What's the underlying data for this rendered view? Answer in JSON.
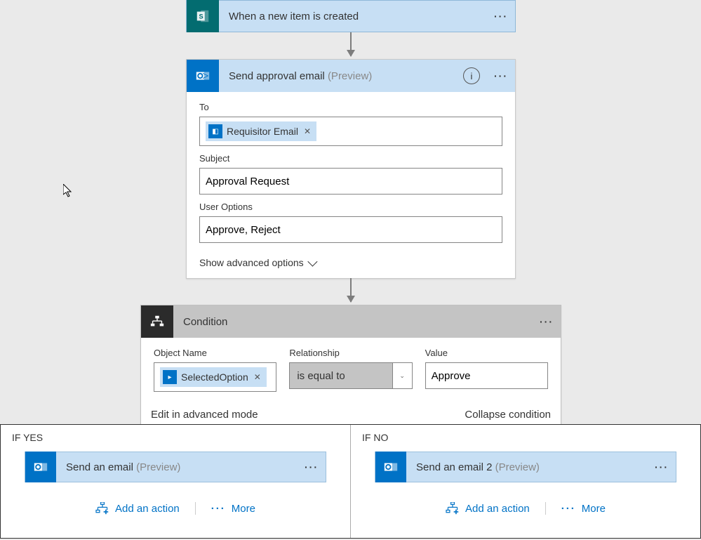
{
  "trigger": {
    "title": "When a new item is created",
    "icon": "sharepoint-icon"
  },
  "emailAction": {
    "title": "Send approval email",
    "preview": "(Preview)",
    "fields": {
      "toLabel": "To",
      "toToken": "Requisitor Email",
      "subjectLabel": "Subject",
      "subjectValue": "Approval Request",
      "optionsLabel": "User Options",
      "optionsValue": "Approve, Reject"
    },
    "showAdvanced": "Show advanced options"
  },
  "condition": {
    "title": "Condition",
    "objectLabel": "Object Name",
    "objectToken": "SelectedOption",
    "relationLabel": "Relationship",
    "relationValue": "is equal to",
    "valueLabel": "Value",
    "valueValue": "Approve",
    "editAdvanced": "Edit in advanced mode",
    "collapse": "Collapse condition"
  },
  "branches": {
    "yes": {
      "label": "IF YES",
      "action": {
        "title": "Send an email",
        "preview": "(Preview)"
      },
      "addAction": "Add an action",
      "more": "More"
    },
    "no": {
      "label": "IF NO",
      "action": {
        "title": "Send an email 2",
        "preview": "(Preview)"
      },
      "addAction": "Add an action",
      "more": "More"
    }
  }
}
